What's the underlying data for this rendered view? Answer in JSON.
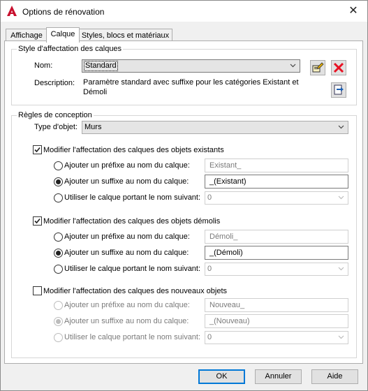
{
  "window": {
    "title": "Options de rénovation",
    "close_glyph": "✕"
  },
  "tabs": [
    {
      "label": "Affichage"
    },
    {
      "label": "Calque"
    },
    {
      "label": "Styles, blocs et matériaux"
    }
  ],
  "style_group": {
    "legend": "Style d'affectation des calques",
    "name_label": "Nom:",
    "name_value": "Standard",
    "description_label": "Description:",
    "description_value": "Paramètre standard avec suffixe pour les catégories Existant et Démoli"
  },
  "rules_group": {
    "legend": "Règles de conception",
    "object_type_label": "Type d'objet:",
    "object_type_value": "Murs",
    "sections": [
      {
        "checkbox_label": "Modifier l'affectation des calques des objets existants",
        "checked": true,
        "prefix_label": "Ajouter un préfixe au nom du calque:",
        "prefix_value": "Existant_",
        "suffix_label": "Ajouter un suffixe au nom du calque:",
        "suffix_value": "_(Existant)",
        "layer_label": "Utiliser le calque portant le nom suivant:",
        "layer_value": "0",
        "selected": "suffix"
      },
      {
        "checkbox_label": "Modifier l'affectation des calques des objets démolis",
        "checked": true,
        "prefix_label": "Ajouter un préfixe au nom du calque:",
        "prefix_value": "Démoli_",
        "suffix_label": "Ajouter un suffixe au nom du calque:",
        "suffix_value": "_(Démoli)",
        "layer_label": "Utiliser le calque portant le nom suivant:",
        "layer_value": "0",
        "selected": "suffix"
      },
      {
        "checkbox_label": "Modifier l'affectation des calques des nouveaux objets",
        "checked": false,
        "prefix_label": "Ajouter un préfixe au nom du calque:",
        "prefix_value": "Nouveau_",
        "suffix_label": "Ajouter un suffixe au nom du calque:",
        "suffix_value": "_(Nouveau)",
        "layer_label": "Utiliser le calque portant le nom suivant:",
        "layer_value": "0",
        "selected": "suffix"
      }
    ]
  },
  "footer": {
    "ok_label": "OK",
    "cancel_label": "Annuler",
    "help_label": "Aide"
  },
  "icons": {
    "app": "autocad-a-icon",
    "edit": "edit-style-icon",
    "delete": "delete-x-icon",
    "import": "import-export-icon"
  },
  "colors": {
    "accent": "#0078d7",
    "delete_red": "#e81123",
    "app_red": "#c8102e"
  }
}
